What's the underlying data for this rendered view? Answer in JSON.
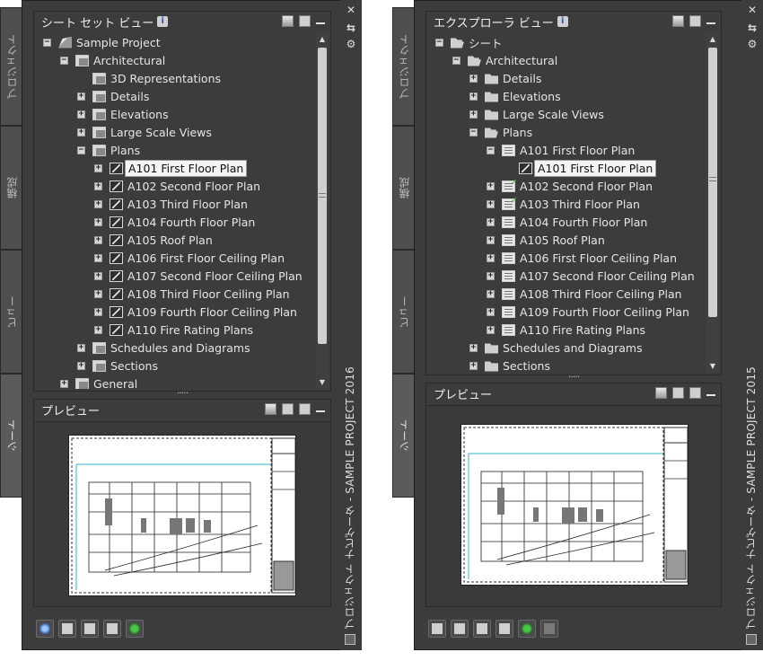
{
  "left": {
    "vertical_title": "プロジェクト ナビゲータ - SAMPLE PROJECT 2016",
    "tabs": [
      {
        "label": "プロジェクト",
        "active": false
      },
      {
        "label": "構成",
        "active": false
      },
      {
        "label": "ビュー",
        "active": false
      },
      {
        "label": "シート",
        "active": true
      }
    ],
    "tree_title": "シート セット ビュー",
    "info_label": "i",
    "preview_title": "プレビュー",
    "tree": [
      {
        "label": "Sample Project",
        "icon": "sheetset-icon",
        "expander": "−",
        "indent": 0
      },
      {
        "label": "Architectural",
        "icon": "subset-icon",
        "expander": "−",
        "indent": 1
      },
      {
        "label": "3D Representations",
        "icon": "subset-icon",
        "expander": "",
        "indent": 2
      },
      {
        "label": "Details",
        "icon": "subset-icon",
        "expander": "+",
        "indent": 2
      },
      {
        "label": "Elevations",
        "icon": "subset-icon",
        "expander": "+",
        "indent": 2
      },
      {
        "label": "Large Scale Views",
        "icon": "subset-icon",
        "expander": "+",
        "indent": 2
      },
      {
        "label": "Plans",
        "icon": "subset-icon",
        "expander": "−",
        "indent": 2
      },
      {
        "label": "A101 First Floor Plan",
        "icon": "sheet-icon",
        "expander": "+",
        "indent": 3,
        "selected": true
      },
      {
        "label": "A102 Second Floor Plan",
        "icon": "sheet-icon",
        "expander": "+",
        "indent": 3
      },
      {
        "label": "A103 Third Floor Plan",
        "icon": "sheet-icon",
        "expander": "+",
        "indent": 3
      },
      {
        "label": "A104 Fourth Floor Plan",
        "icon": "sheet-icon",
        "expander": "+",
        "indent": 3
      },
      {
        "label": "A105 Roof Plan",
        "icon": "sheet-icon",
        "expander": "+",
        "indent": 3
      },
      {
        "label": "A106 First Floor Ceiling Plan",
        "icon": "sheet-icon",
        "expander": "+",
        "indent": 3
      },
      {
        "label": "A107 Second Floor Ceiling Plan",
        "icon": "sheet-icon",
        "expander": "+",
        "indent": 3
      },
      {
        "label": "A108 Third Floor Ceiling Plan",
        "icon": "sheet-icon",
        "expander": "+",
        "indent": 3
      },
      {
        "label": "A109 Fourth Floor Ceiling Plan",
        "icon": "sheet-icon",
        "expander": "+",
        "indent": 3
      },
      {
        "label": "A110 Fire Rating Plans",
        "icon": "sheet-icon",
        "expander": "+",
        "indent": 3
      },
      {
        "label": "Schedules and Diagrams",
        "icon": "subset-icon",
        "expander": "+",
        "indent": 2
      },
      {
        "label": "Sections",
        "icon": "subset-icon",
        "expander": "+",
        "indent": 2
      },
      {
        "label": "General",
        "icon": "subset-icon",
        "expander": "+",
        "indent": 1
      }
    ],
    "toolbar": [
      "globe-icon",
      "new-sheet-icon",
      "tools-icon",
      "properties-icon",
      "refresh-icon"
    ]
  },
  "right": {
    "vertical_title": "プロジェクト ナビゲータ - SAMPLE PROJECT 2015",
    "tabs": [
      {
        "label": "プロジェクト",
        "active": false
      },
      {
        "label": "構成",
        "active": false
      },
      {
        "label": "ビュー",
        "active": false
      },
      {
        "label": "シート",
        "active": true
      }
    ],
    "tree_title": "エクスプローラ ビュー",
    "info_label": "i",
    "preview_title": "プレビュー",
    "tree": [
      {
        "label": "シート",
        "icon": "folder-open-icon",
        "expander": "−",
        "indent": 0
      },
      {
        "label": "Architectural",
        "icon": "folder-open-icon",
        "expander": "−",
        "indent": 1
      },
      {
        "label": "Details",
        "icon": "folder-icon",
        "expander": "+",
        "indent": 2
      },
      {
        "label": "Elevations",
        "icon": "folder-icon",
        "expander": "+",
        "indent": 2
      },
      {
        "label": "Large Scale Views",
        "icon": "folder-icon",
        "expander": "+",
        "indent": 2
      },
      {
        "label": "Plans",
        "icon": "folder-open-icon",
        "expander": "−",
        "indent": 2
      },
      {
        "label": "A101 First Floor Plan",
        "icon": "dwg-icon",
        "expander": "−",
        "indent": 3
      },
      {
        "label": "A101 First Floor Plan",
        "icon": "sheet-icon",
        "expander": "",
        "indent": 4,
        "selected": true
      },
      {
        "label": "A102 Second Floor Plan",
        "icon": "dwg-icon",
        "expander": "+",
        "indent": 3,
        "check": true
      },
      {
        "label": "A103 Third Floor Plan",
        "icon": "dwg-icon",
        "expander": "+",
        "indent": 3,
        "check": true
      },
      {
        "label": "A104 Fourth Floor Plan",
        "icon": "dwg-icon",
        "expander": "+",
        "indent": 3
      },
      {
        "label": "A105 Roof Plan",
        "icon": "dwg-icon",
        "expander": "+",
        "indent": 3
      },
      {
        "label": "A106 First Floor Ceiling Plan",
        "icon": "dwg-icon",
        "expander": "+",
        "indent": 3
      },
      {
        "label": "A107 Second Floor Ceiling Plan",
        "icon": "dwg-icon",
        "expander": "+",
        "indent": 3
      },
      {
        "label": "A108 Third Floor Ceiling Plan",
        "icon": "dwg-icon",
        "expander": "+",
        "indent": 3
      },
      {
        "label": "A109 Fourth Floor Ceiling Plan",
        "icon": "dwg-icon",
        "expander": "+",
        "indent": 3
      },
      {
        "label": "A110 Fire Rating Plans",
        "icon": "dwg-icon",
        "expander": "+",
        "indent": 3
      },
      {
        "label": "Schedules and Diagrams",
        "icon": "folder-icon",
        "expander": "+",
        "indent": 2
      },
      {
        "label": "Sections",
        "icon": "folder-icon",
        "expander": "+",
        "indent": 2
      }
    ],
    "toolbar": [
      "new-sheet-icon",
      "clipboard-icon",
      "tools-icon",
      "properties-icon",
      "refresh-icon",
      "disabled-icon"
    ]
  },
  "controls": {
    "close": "✕",
    "autohide": "⇆",
    "settings": "⚙"
  }
}
